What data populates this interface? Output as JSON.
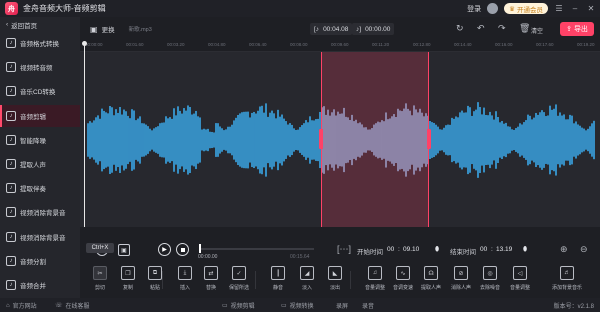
{
  "app": {
    "logo": "舟",
    "title": "金舟音频大师-音频剪辑",
    "login": "登录",
    "vip": "开通会员"
  },
  "sidebar": {
    "back": "返回首页",
    "items": [
      {
        "label": "音频格式转换",
        "icon": "music-file-icon"
      },
      {
        "label": "视频转音频",
        "icon": "video-icon"
      },
      {
        "label": "音乐CD转换",
        "icon": "cd-icon"
      },
      {
        "label": "音频剪辑",
        "icon": "cut-audio-icon",
        "active": true
      },
      {
        "label": "智能降噪",
        "icon": "denoise-icon"
      },
      {
        "label": "提取人声",
        "icon": "voice-icon"
      },
      {
        "label": "提取伴奏",
        "icon": "accompaniment-icon"
      },
      {
        "label": "视频消除背景音",
        "icon": "video-mute-icon"
      },
      {
        "label": "视频消除背景音",
        "icon": "video-mute-icon"
      },
      {
        "label": "音频分割",
        "icon": "split-icon"
      },
      {
        "label": "音频合并",
        "icon": "merge-icon"
      }
    ]
  },
  "toolbar": {
    "change": "更换",
    "file_name": "新歌.mp3",
    "sel_start": "00:04.08",
    "sel_end": "00:00.00",
    "clear": "清空",
    "export": "导出"
  },
  "ruler": {
    "ticks": [
      "00:00:00",
      "00:01.60",
      "00:03.20",
      "00:04.80",
      "00:06.40",
      "00:08.00",
      "00:09.60",
      "00:11.20",
      "00:12.80",
      "00:14.40",
      "00:16.00",
      "00:17.60",
      "00:19.20"
    ]
  },
  "transport": {
    "current_time": "00:00.00",
    "total_time": "00:15.64",
    "progress": 0.0,
    "start_label": "开始时间",
    "start_min": "00",
    "start_sec": "09.10",
    "end_label": "结束时间",
    "end_min": "00",
    "end_sec": "13.19",
    "tooltip": "Ctrl+X"
  },
  "tools": [
    {
      "label": "剪切",
      "glyph": "✂"
    },
    {
      "label": "复制",
      "glyph": "❐"
    },
    {
      "label": "粘贴",
      "glyph": "⧉"
    },
    {
      "label": "插入",
      "glyph": "⤓"
    },
    {
      "label": "替换",
      "glyph": "⇄"
    },
    {
      "label": "保留所选",
      "glyph": "✓"
    },
    {
      "label": "静音",
      "glyph": "┃"
    },
    {
      "label": "淡入",
      "glyph": "◢"
    },
    {
      "label": "淡出",
      "glyph": "◣"
    },
    {
      "label": "音量调整",
      "glyph": "♫"
    },
    {
      "label": "音调变速",
      "glyph": "∿"
    },
    {
      "label": "提取人声",
      "glyph": "☊"
    },
    {
      "label": "消除人声",
      "glyph": "⊘"
    },
    {
      "label": "去除噪音",
      "glyph": "◎"
    },
    {
      "label": "音量调整",
      "glyph": "◁"
    },
    {
      "label": "添加背景音乐",
      "glyph": "♬"
    }
  ],
  "footer": {
    "website": "官方网站",
    "support": "在线客服",
    "links": [
      "视频剪辑",
      "视频转换",
      "录屏",
      "录音"
    ],
    "version": "版本号：v2.1.8"
  },
  "colors": {
    "accent": "#ff4267",
    "wave": "#3aa7e8",
    "wave_selected": "#7fb3dc"
  }
}
